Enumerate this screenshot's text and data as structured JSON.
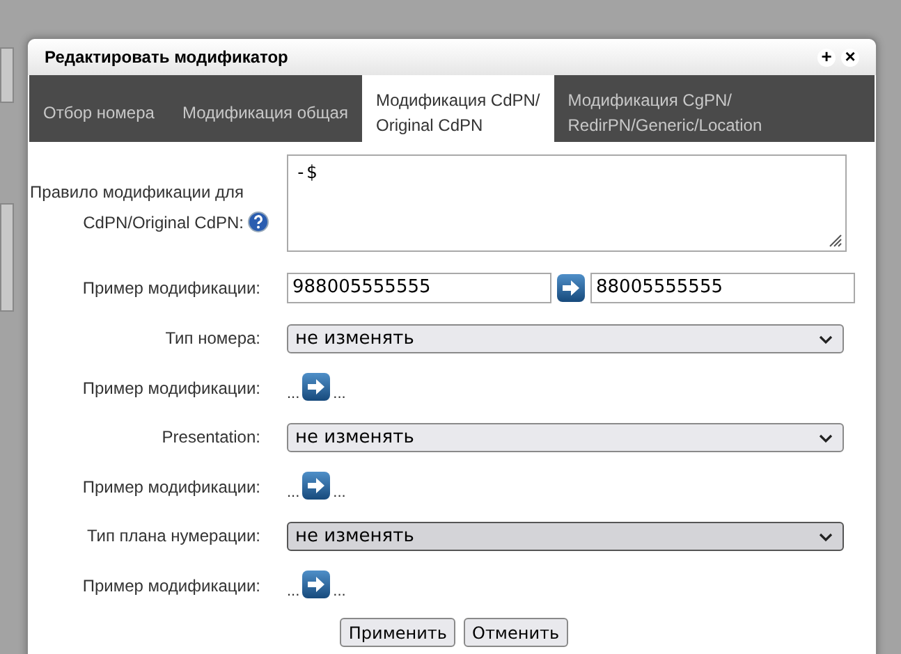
{
  "dialog": {
    "title": "Редактировать модификатор",
    "buttons": [
      "+",
      "×"
    ]
  },
  "tabs": [
    {
      "label": "Отбор номера",
      "selected": false
    },
    {
      "label": "Модификация общая",
      "selected": false
    },
    {
      "label": "Модификация CdPN/\nOriginal CdPN",
      "selected": true
    },
    {
      "label": "Модификация CgPN/\nRedirPN/Generic/Location",
      "selected": false
    }
  ],
  "rows": [
    {
      "kind": "textarea",
      "label": "Правило модификации для CdPN/Original CdPN:",
      "value": "-$"
    },
    {
      "kind": "example",
      "label": "Пример модификации:",
      "input": "988005555555",
      "output": "88005555555"
    },
    {
      "kind": "select",
      "label": "Тип номера:",
      "value": "не изменять",
      "focused": false
    },
    {
      "kind": "example_empty",
      "label": "Пример модификации:",
      "before": "...",
      "after": "..."
    },
    {
      "kind": "select",
      "label": "Presentation:",
      "value": "не изменять",
      "focused": false
    },
    {
      "kind": "example_empty",
      "label": "Пример модификации:",
      "before": "...",
      "after": "..."
    },
    {
      "kind": "select",
      "label": "Тип плана нумерации:",
      "value": "не изменять",
      "focused": true
    },
    {
      "kind": "example_empty",
      "label": "Пример модификации:",
      "before": "...",
      "after": "..."
    }
  ],
  "buttons": [
    "Применить",
    "Отменить"
  ]
}
